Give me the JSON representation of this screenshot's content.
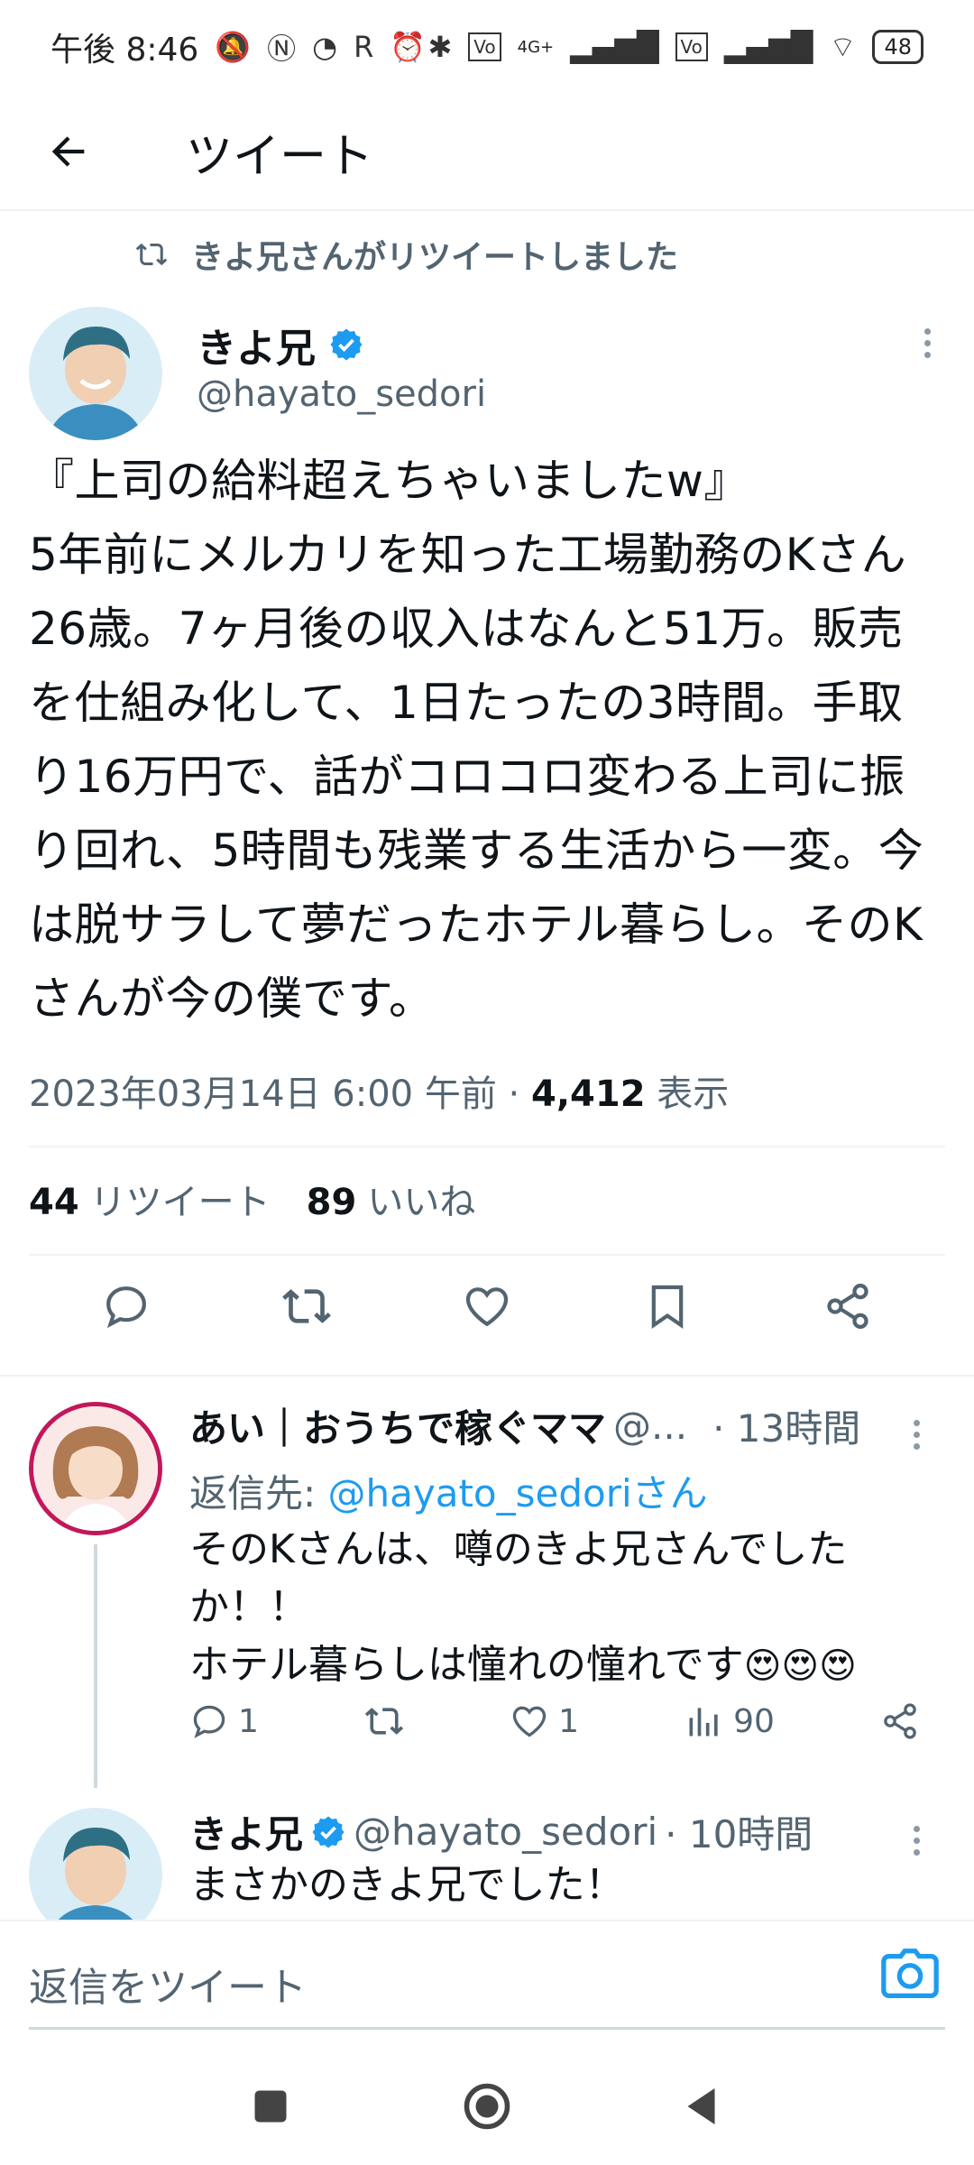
{
  "status_bar": {
    "time": "午後 8:46",
    "network_labels": [
      "4G+"
    ],
    "battery": "48"
  },
  "header": {
    "title": "ツイート"
  },
  "retweet_banner": "きよ兄さんがリツイートしました",
  "tweet": {
    "author_name": "きよ兄",
    "author_handle": "@hayato_sedori",
    "text": "『上司の給料超えちゃいましたw』\n5年前にメルカリを知った工場勤務のKさん26歳。7ヶ月後の収入はなんと51万。販売を仕組み化して、1日たったの3時間。手取り16万円で、話がコロコロ変わる上司に振り回れ、5時間も残業する生活から一変。今は脱サラして夢だったホテル暮らし。そのKさんが今の僕です。",
    "timestamp": "2023年03月14日 6:00 午前 · ",
    "views_count": "4,412",
    "views_label": " 表示",
    "retweets_count": "44",
    "retweets_label": "リツイート",
    "likes_count": "89",
    "likes_label": "いいね"
  },
  "replies": [
    {
      "author_name": "あい｜おうちで稼ぐママ",
      "author_handle": "@...",
      "time": "· 13時間",
      "reply_to_prefix": "返信先: ",
      "reply_to_handle": "@hayato_sedoriさん",
      "text": "そのKさんは、噂のきよ兄さんでした\nか！！\nホテル暮らしは憧れの憧れです",
      "emojis": "😍😍😍",
      "reply_count": "1",
      "like_count": "1",
      "view_count": "90"
    },
    {
      "author_name": "きよ兄",
      "author_handle": "@hayato_sedori",
      "time": "· 10時間",
      "text": "まさかのきよ兄でした！"
    }
  ],
  "compose": {
    "placeholder": "返信をツイート"
  },
  "colors": {
    "accent": "#1d9bf0",
    "text": "#0f1419",
    "secondary": "#536471",
    "divider": "#eff3f4"
  }
}
